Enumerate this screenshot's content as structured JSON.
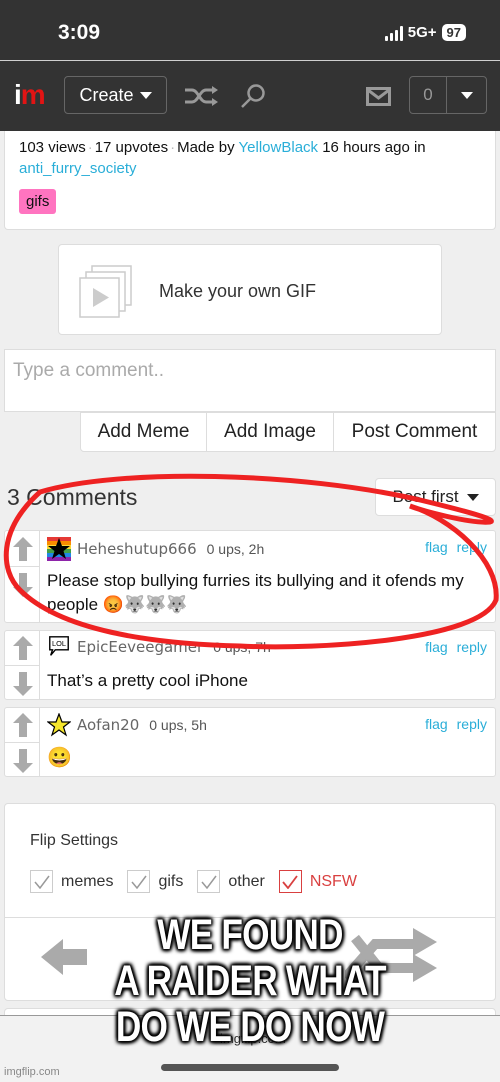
{
  "status_bar": {
    "time": "3:09",
    "network": "5G+",
    "battery": "97"
  },
  "navbar": {
    "logo_i": "i",
    "logo_m": "m",
    "create_label": "Create",
    "notification_count": "0",
    "icons": [
      "shuffle-icon",
      "search-icon",
      "mail-icon",
      "chevron-down-icon"
    ]
  },
  "post_meta": {
    "views": "103 views",
    "upvotes": "17 upvotes",
    "made_by_prefix": "Made by",
    "author": "YellowBlack",
    "time_suffix": "16 hours ago in",
    "stream": "anti_furry_society",
    "tag": "gifs"
  },
  "gif_promo": {
    "label": "Make your own GIF"
  },
  "comment_box": {
    "placeholder": "Type a comment..",
    "buttons": [
      "Add Meme",
      "Add Image",
      "Post Comment"
    ]
  },
  "comments_header": {
    "title": "3 Comments",
    "sort": "Best first"
  },
  "comments": [
    {
      "username": "Heheshutup666",
      "meta": "0 ups, 2h",
      "flag": "flag",
      "reply": "reply",
      "text": "Please stop bullying furries its bullying and it ofends my people 😡🐺🐺🐺",
      "avatar": "rainbow-star-avatar"
    },
    {
      "username": "EpicEeveegamer",
      "meta": "0 ups, 7h",
      "flag": "flag",
      "reply": "reply",
      "text": "That’s a pretty cool iPhone",
      "avatar": "lol-speech-avatar"
    },
    {
      "username": "Aofan20",
      "meta": "0 ups, 5h",
      "flag": "flag",
      "reply": "reply",
      "text": "😀",
      "avatar": "yellow-star-avatar"
    }
  ],
  "flip_settings": {
    "title": "Flip Settings",
    "options": [
      {
        "label": "memes",
        "checked": true
      },
      {
        "label": "gifs",
        "checked": true
      },
      {
        "label": "other",
        "checked": true
      },
      {
        "label": "NSFW",
        "checked": true
      }
    ]
  },
  "bottom_bar": {
    "url": "imgflip.com"
  },
  "meme_caption": {
    "line1": "WE FOUND",
    "line2": "A RAIDER WHAT",
    "line3": "DO WE DO NOW"
  },
  "watermark": "imgflip.com",
  "colors": {
    "link": "#2aaed8",
    "tag": "#ff74c0",
    "nsfw": "#d94040",
    "logo_red": "#e21414",
    "navbar": "#333333",
    "annotation": "#ee2222"
  }
}
